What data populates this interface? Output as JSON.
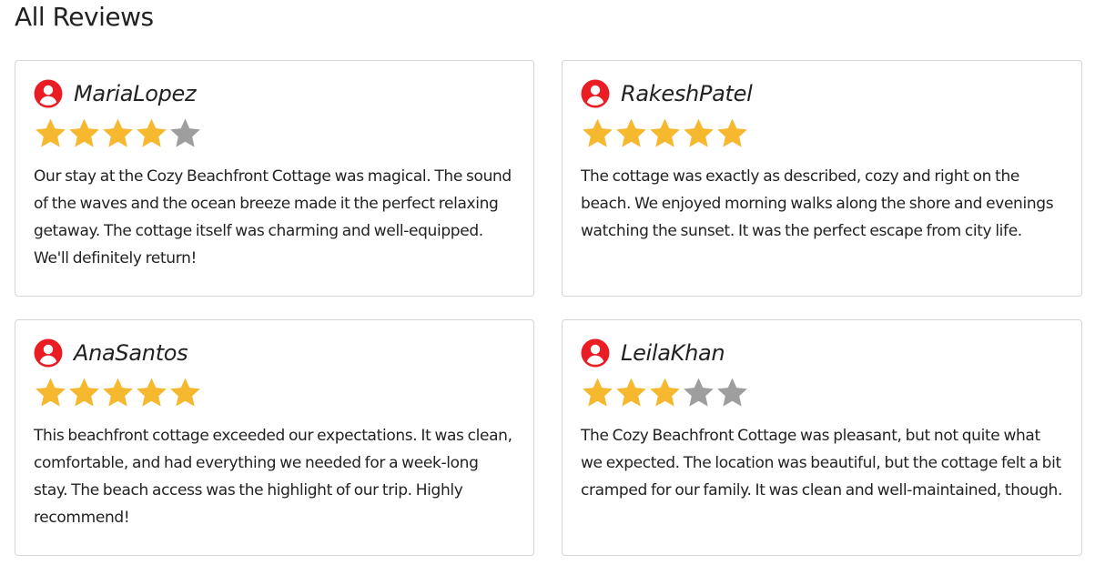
{
  "section": {
    "title": "All Reviews"
  },
  "colors": {
    "icon_red": "#ea1c24",
    "star_filled": "#f5b82e",
    "star_empty": "#9e9e9e"
  },
  "reviews": [
    {
      "name": "MariaLopez",
      "rating": 4,
      "max_rating": 5,
      "icon": "user-circle-icon",
      "text": "Our stay at the Cozy Beachfront Cottage was magical. The sound of the waves and the ocean breeze made it the perfect relaxing getaway. The cottage itself was charming and well-equipped. We'll definitely return!"
    },
    {
      "name": "RakeshPatel",
      "rating": 5,
      "max_rating": 5,
      "icon": "user-circle-icon",
      "text": "The cottage was exactly as described, cozy and right on the beach. We enjoyed morning walks along the shore and evenings watching the sunset. It was the perfect escape from city life."
    },
    {
      "name": "AnaSantos",
      "rating": 5,
      "max_rating": 5,
      "icon": "user-circle-icon",
      "text": "This beachfront cottage exceeded our expectations. It was clean, comfortable, and had everything we needed for a week-long stay. The beach access was the highlight of our trip. Highly recommend!"
    },
    {
      "name": "LeilaKhan",
      "rating": 3,
      "max_rating": 5,
      "icon": "user-circle-icon",
      "text": "The Cozy Beachfront Cottage was pleasant, but not quite what we expected. The location was beautiful, but the cottage felt a bit cramped for our family. It was clean and well-maintained, though."
    }
  ]
}
